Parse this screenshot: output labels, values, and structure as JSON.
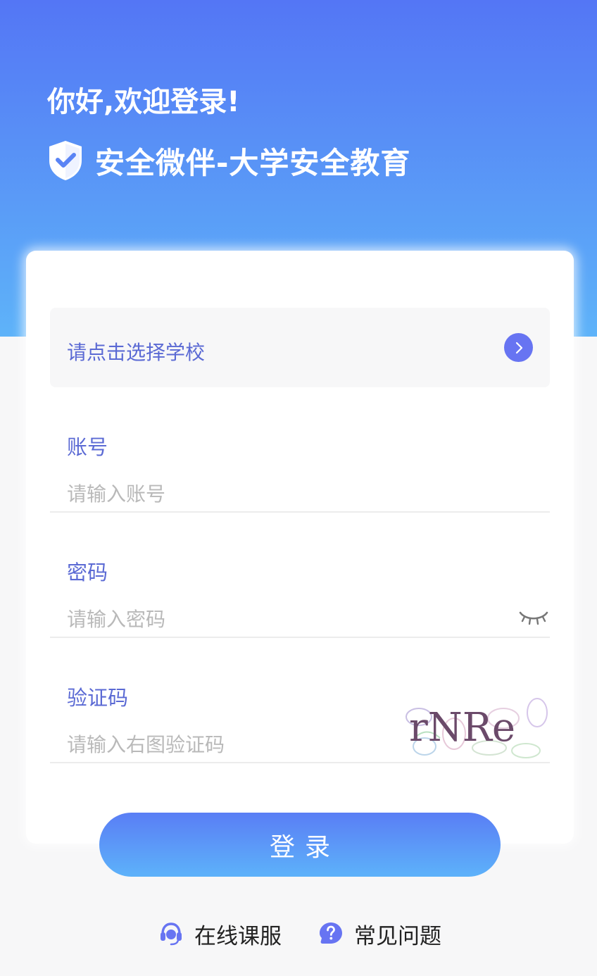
{
  "header": {
    "greeting": "你好,欢迎登录!",
    "brand_title": "安全微伴-大学安全教育",
    "logo_icon": "shield-check-icon"
  },
  "form": {
    "school_select_label": "请点击选择学校",
    "account": {
      "label": "账号",
      "placeholder": "请输入账号",
      "value": ""
    },
    "password": {
      "label": "密码",
      "placeholder": "请输入密码",
      "value": "",
      "toggle_icon": "eye-closed-icon"
    },
    "captcha": {
      "label": "验证码",
      "placeholder": "请输入右图验证码",
      "value": "",
      "image_text": "rNRe"
    },
    "login_button": "登录"
  },
  "footer": {
    "service": {
      "label": "在线课服",
      "icon": "headset-icon"
    },
    "faq": {
      "label": "常见问题",
      "icon": "question-bubble-icon"
    }
  },
  "colors": {
    "primary": "#6774f2",
    "label": "#5b6ad4",
    "gradient_top": "#5476f5",
    "gradient_bottom": "#5eb3f9"
  }
}
